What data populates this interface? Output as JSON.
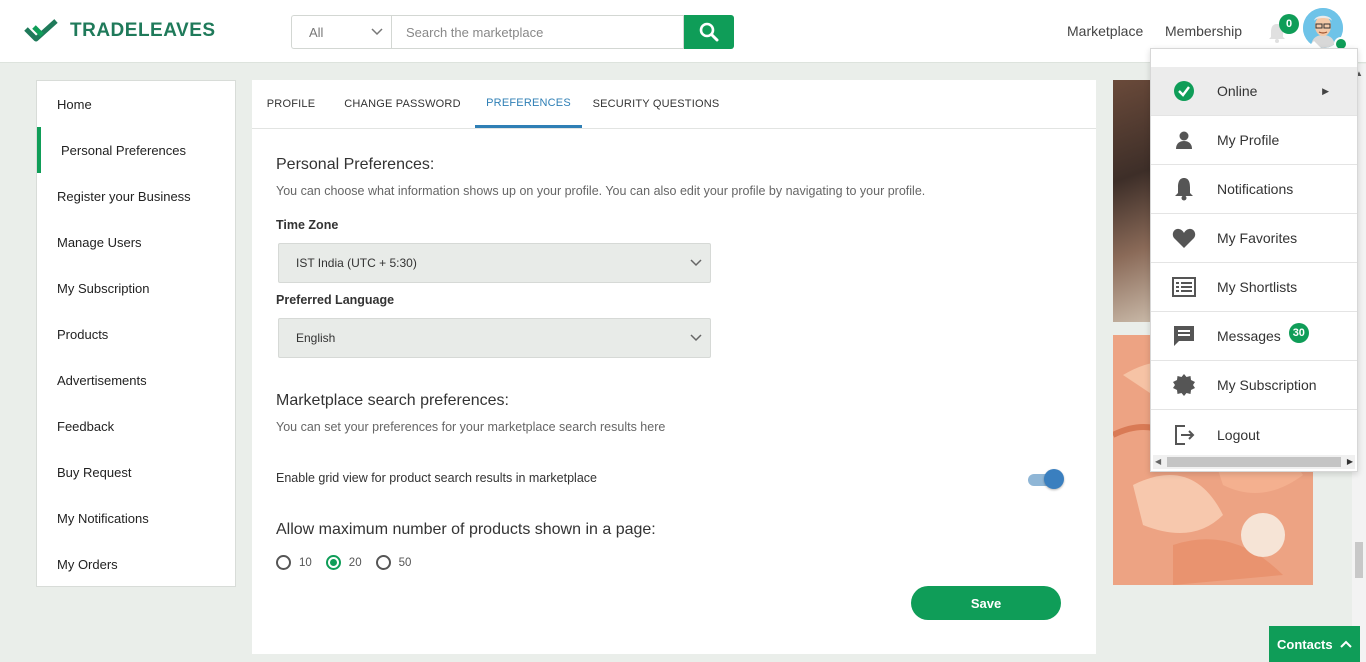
{
  "brand": {
    "name": "TRADELEAVES",
    "color": "#0f9d58"
  },
  "search": {
    "category": "All",
    "placeholder": "Search the marketplace"
  },
  "nav": {
    "marketplace": "Marketplace",
    "membership": "Membership",
    "notif_count": "0"
  },
  "sidebar": {
    "items": [
      {
        "label": "Home"
      },
      {
        "label": "Personal Preferences",
        "active": true
      },
      {
        "label": "Register your Business"
      },
      {
        "label": "Manage Users"
      },
      {
        "label": "My Subscription"
      },
      {
        "label": "Products"
      },
      {
        "label": "Advertisements"
      },
      {
        "label": "Feedback"
      },
      {
        "label": "Buy Request"
      },
      {
        "label": "My Notifications"
      },
      {
        "label": "My Orders"
      }
    ]
  },
  "tabs": [
    {
      "label": "PROFILE"
    },
    {
      "label": "CHANGE PASSWORD"
    },
    {
      "label": "PREFERENCES",
      "active": true
    },
    {
      "label": "SECURITY QUESTIONS"
    }
  ],
  "prefs": {
    "title": "Personal Preferences:",
    "desc": "You can choose what information shows up on your profile. You can also edit your profile by navigating to your profile.",
    "timezone_label": "Time Zone",
    "timezone_value": "IST India (UTC + 5:30)",
    "language_label": "Preferred Language",
    "language_value": "English"
  },
  "market": {
    "title": "Marketplace search preferences:",
    "desc": "You can set your preferences for your marketplace search results here",
    "grid_label": "Enable grid view for product search results in marketplace",
    "grid_enabled": true
  },
  "max_products": {
    "title": "Allow maximum number of products shown in a page:",
    "options": [
      "10",
      "20",
      "50"
    ],
    "selected": "20"
  },
  "save_label": "Save",
  "dropdown": {
    "items": [
      {
        "label": "Online",
        "icon": "check-circle-icon"
      },
      {
        "label": "My Profile",
        "icon": "person-icon"
      },
      {
        "label": "Notifications",
        "icon": "bell-icon"
      },
      {
        "label": "My Favorites",
        "icon": "heart-icon"
      },
      {
        "label": "My Shortlists",
        "icon": "list-icon"
      },
      {
        "label": "Messages",
        "icon": "message-icon",
        "badge": "30"
      },
      {
        "label": "My Subscription",
        "icon": "badge-icon"
      },
      {
        "label": "Logout",
        "icon": "logout-icon"
      }
    ]
  },
  "contacts_label": "Contacts"
}
